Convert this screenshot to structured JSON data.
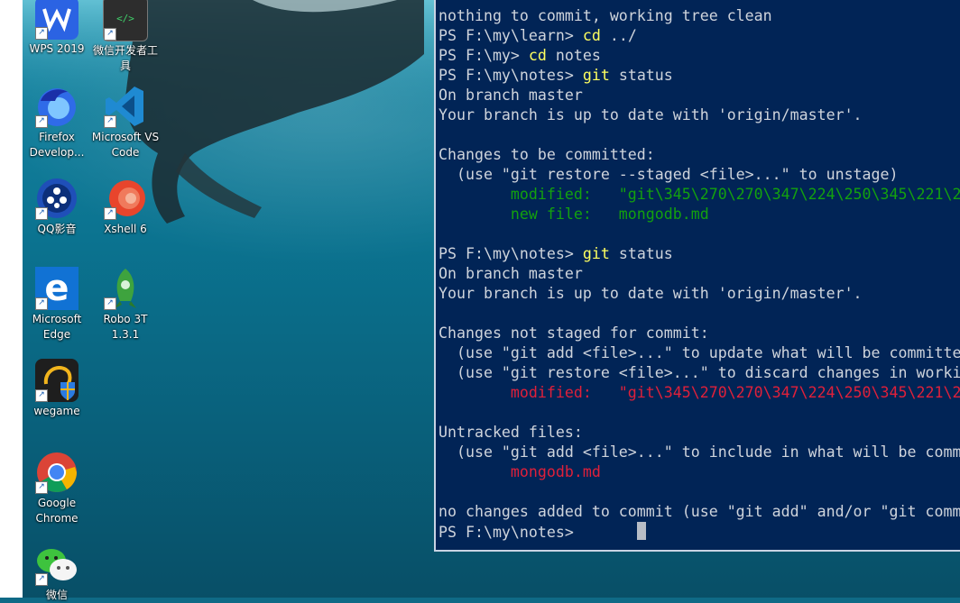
{
  "desktop": {
    "icons": [
      {
        "label": "WPS 2019",
        "icon": "wps-icon"
      },
      {
        "label": "微信开发者工具",
        "icon": "wechat-devtools-icon"
      },
      {
        "label": "Firefox Develop...",
        "icon": "firefox-developer-icon"
      },
      {
        "label": "Microsoft VS Code",
        "icon": "vscode-icon"
      },
      {
        "label": "QQ影音",
        "icon": "qq-player-icon"
      },
      {
        "label": "Xshell 6",
        "icon": "xshell-icon"
      },
      {
        "label": "Microsoft Edge",
        "icon": "edge-icon"
      },
      {
        "label": "Robo 3T 1.3.1",
        "icon": "robo3t-icon"
      },
      {
        "label": "wegame",
        "icon": "wegame-icon"
      },
      {
        "label": "Google Chrome",
        "icon": "chrome-icon"
      },
      {
        "label": "微信",
        "icon": "wechat-icon"
      }
    ],
    "devtools_glyph": "</>"
  },
  "terminal": {
    "lines": [
      {
        "t": "nothing to commit, working tree clean"
      },
      {
        "prompt": "PS F:\\my\\learn> ",
        "cmd": "cd",
        "rest": " ../"
      },
      {
        "prompt": "PS F:\\my> ",
        "cmd": "cd",
        "rest": " notes"
      },
      {
        "prompt": "PS F:\\my\\notes> ",
        "cmd": "git",
        "rest": " status"
      },
      {
        "t": "On branch master"
      },
      {
        "t": "Your branch is up to date with 'origin/master'."
      },
      {
        "t": ""
      },
      {
        "t": "Changes to be committed:"
      },
      {
        "t": "  (use \"git restore --staged <file>...\" to unstage)"
      },
      {
        "t": "        modified:   \"git\\345\\270\\270\\347\\224\\250\\345\\221\\2",
        "color": "green"
      },
      {
        "t": "        new file:   mongodb.md",
        "color": "green"
      },
      {
        "t": ""
      },
      {
        "prompt": "PS F:\\my\\notes> ",
        "cmd": "git",
        "rest": " status"
      },
      {
        "t": "On branch master"
      },
      {
        "t": "Your branch is up to date with 'origin/master'."
      },
      {
        "t": ""
      },
      {
        "t": "Changes not staged for commit:"
      },
      {
        "t": "  (use \"git add <file>...\" to update what will be committe"
      },
      {
        "t": "  (use \"git restore <file>...\" to discard changes in worki"
      },
      {
        "t": "        modified:   \"git\\345\\270\\270\\347\\224\\250\\345\\221\\2",
        "color": "red"
      },
      {
        "t": ""
      },
      {
        "t": "Untracked files:"
      },
      {
        "t": "  (use \"git add <file>...\" to include in what will be comm"
      },
      {
        "t": "        mongodb.md",
        "color": "red"
      },
      {
        "t": ""
      },
      {
        "t": "no changes added to commit (use \"git add\" and/or \"git comm"
      }
    ],
    "current_prompt": "PS F:\\my\\notes> ",
    "colors": {
      "background": "#012456",
      "text": "#cfd4dc",
      "command": "#ffff60",
      "staged": "#13a10e",
      "unstaged": "#e0203a"
    }
  }
}
